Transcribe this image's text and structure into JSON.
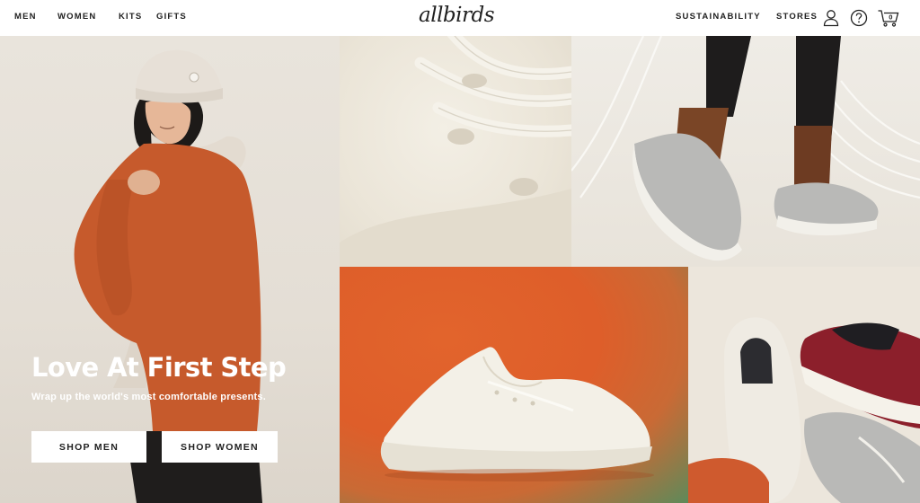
{
  "nav": {
    "left": [
      "MEN",
      "WOMEN",
      "KITS",
      "GIFTS"
    ],
    "right": [
      "SUSTAINABILITY",
      "STORES"
    ],
    "cart_count": "0"
  },
  "logo": "allbirds",
  "icons": [
    "account-icon",
    "help-icon",
    "cart-icon"
  ],
  "hero": {
    "title": "Love At First Step",
    "subtitle": "Wrap up the world's most comfortable presents.",
    "buttons": [
      "SHOP MEN",
      "SHOP WOMEN"
    ]
  },
  "colors": {
    "text": "#212121",
    "orange_panel": "#de5e2a",
    "sweater": "#c65a2c",
    "shoe_grey": "#b9b9b7",
    "shoe_red": "#8c1f2b"
  }
}
